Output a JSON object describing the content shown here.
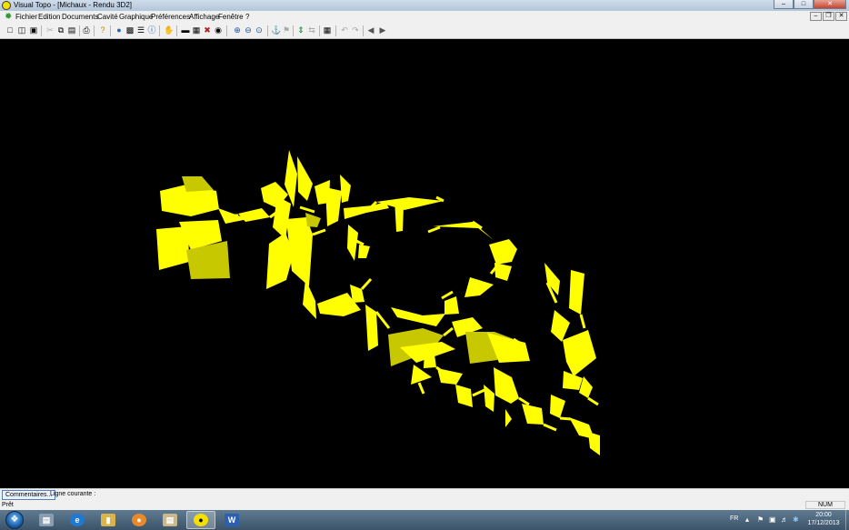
{
  "window": {
    "title": "Visual Topo - [Michaux - Rendu 3D2]",
    "app_icon": "visual-topo-icon",
    "controls": [
      "minimize-icon",
      "maximize-icon",
      "close-icon"
    ]
  },
  "menubar": {
    "icon": "gear-icon",
    "items": [
      "Fichier",
      "Edition",
      "Documents",
      "Cavité",
      "Graphique",
      "Préférences",
      "Affichage",
      "Fenêtre",
      "?"
    ],
    "document_controls": [
      "minimize-icon",
      "restore-icon",
      "close-icon"
    ]
  },
  "toolbar": {
    "groups": [
      [
        "new-icon",
        "open-icon",
        "save-icon"
      ],
      [
        "cut-icon",
        "copy-icon",
        "paste-icon"
      ],
      [
        "print-icon"
      ],
      [
        "help-icon"
      ],
      [
        "globe-icon",
        "database-icon",
        "list-icon",
        "info-icon"
      ],
      [
        "hand-icon"
      ],
      [
        "ruler-icon",
        "properties-icon",
        "crosshair-icon",
        "render-icon"
      ],
      [
        "zoom-in-icon",
        "zoom-out-icon",
        "zoom-fit-icon"
      ],
      [
        "pick-icon",
        "flag-icon"
      ],
      [
        "vertical-scale-icon",
        "swap-icon"
      ],
      [
        "image-export-icon"
      ],
      [
        "undo-icon",
        "redo-icon"
      ],
      [
        "back-icon",
        "forward-icon"
      ]
    ]
  },
  "viewport": {
    "background": "#000000",
    "model_color": "#ffff00",
    "model_shade": "#c8c800",
    "model_dark": "#8c8c00",
    "description_icon": "cave-survey-3d-render"
  },
  "comments": {
    "button_label": "Commentaires...",
    "current_line_label": "Ligne courante :"
  },
  "status": {
    "text": "Prêt",
    "num_indicator": "NUM"
  },
  "taskbar": {
    "start_icon": "windows-start-icon",
    "apps": [
      {
        "icon": "file-explorer-icon",
        "active": false
      },
      {
        "icon": "internet-explorer-icon",
        "active": false
      },
      {
        "icon": "folder-icon",
        "active": false
      },
      {
        "icon": "paint-icon",
        "active": false
      },
      {
        "icon": "folder-window-icon",
        "active": false
      },
      {
        "icon": "visual-topo-icon",
        "active": true
      },
      {
        "icon": "word-icon",
        "active": false
      }
    ],
    "tray": {
      "language": "FR",
      "icons": [
        "chevron-up-icon",
        "flag-icon",
        "network-icon",
        "volume-icon",
        "bluetooth-icon"
      ],
      "time": "20:00",
      "date": "17/12/2013"
    }
  }
}
